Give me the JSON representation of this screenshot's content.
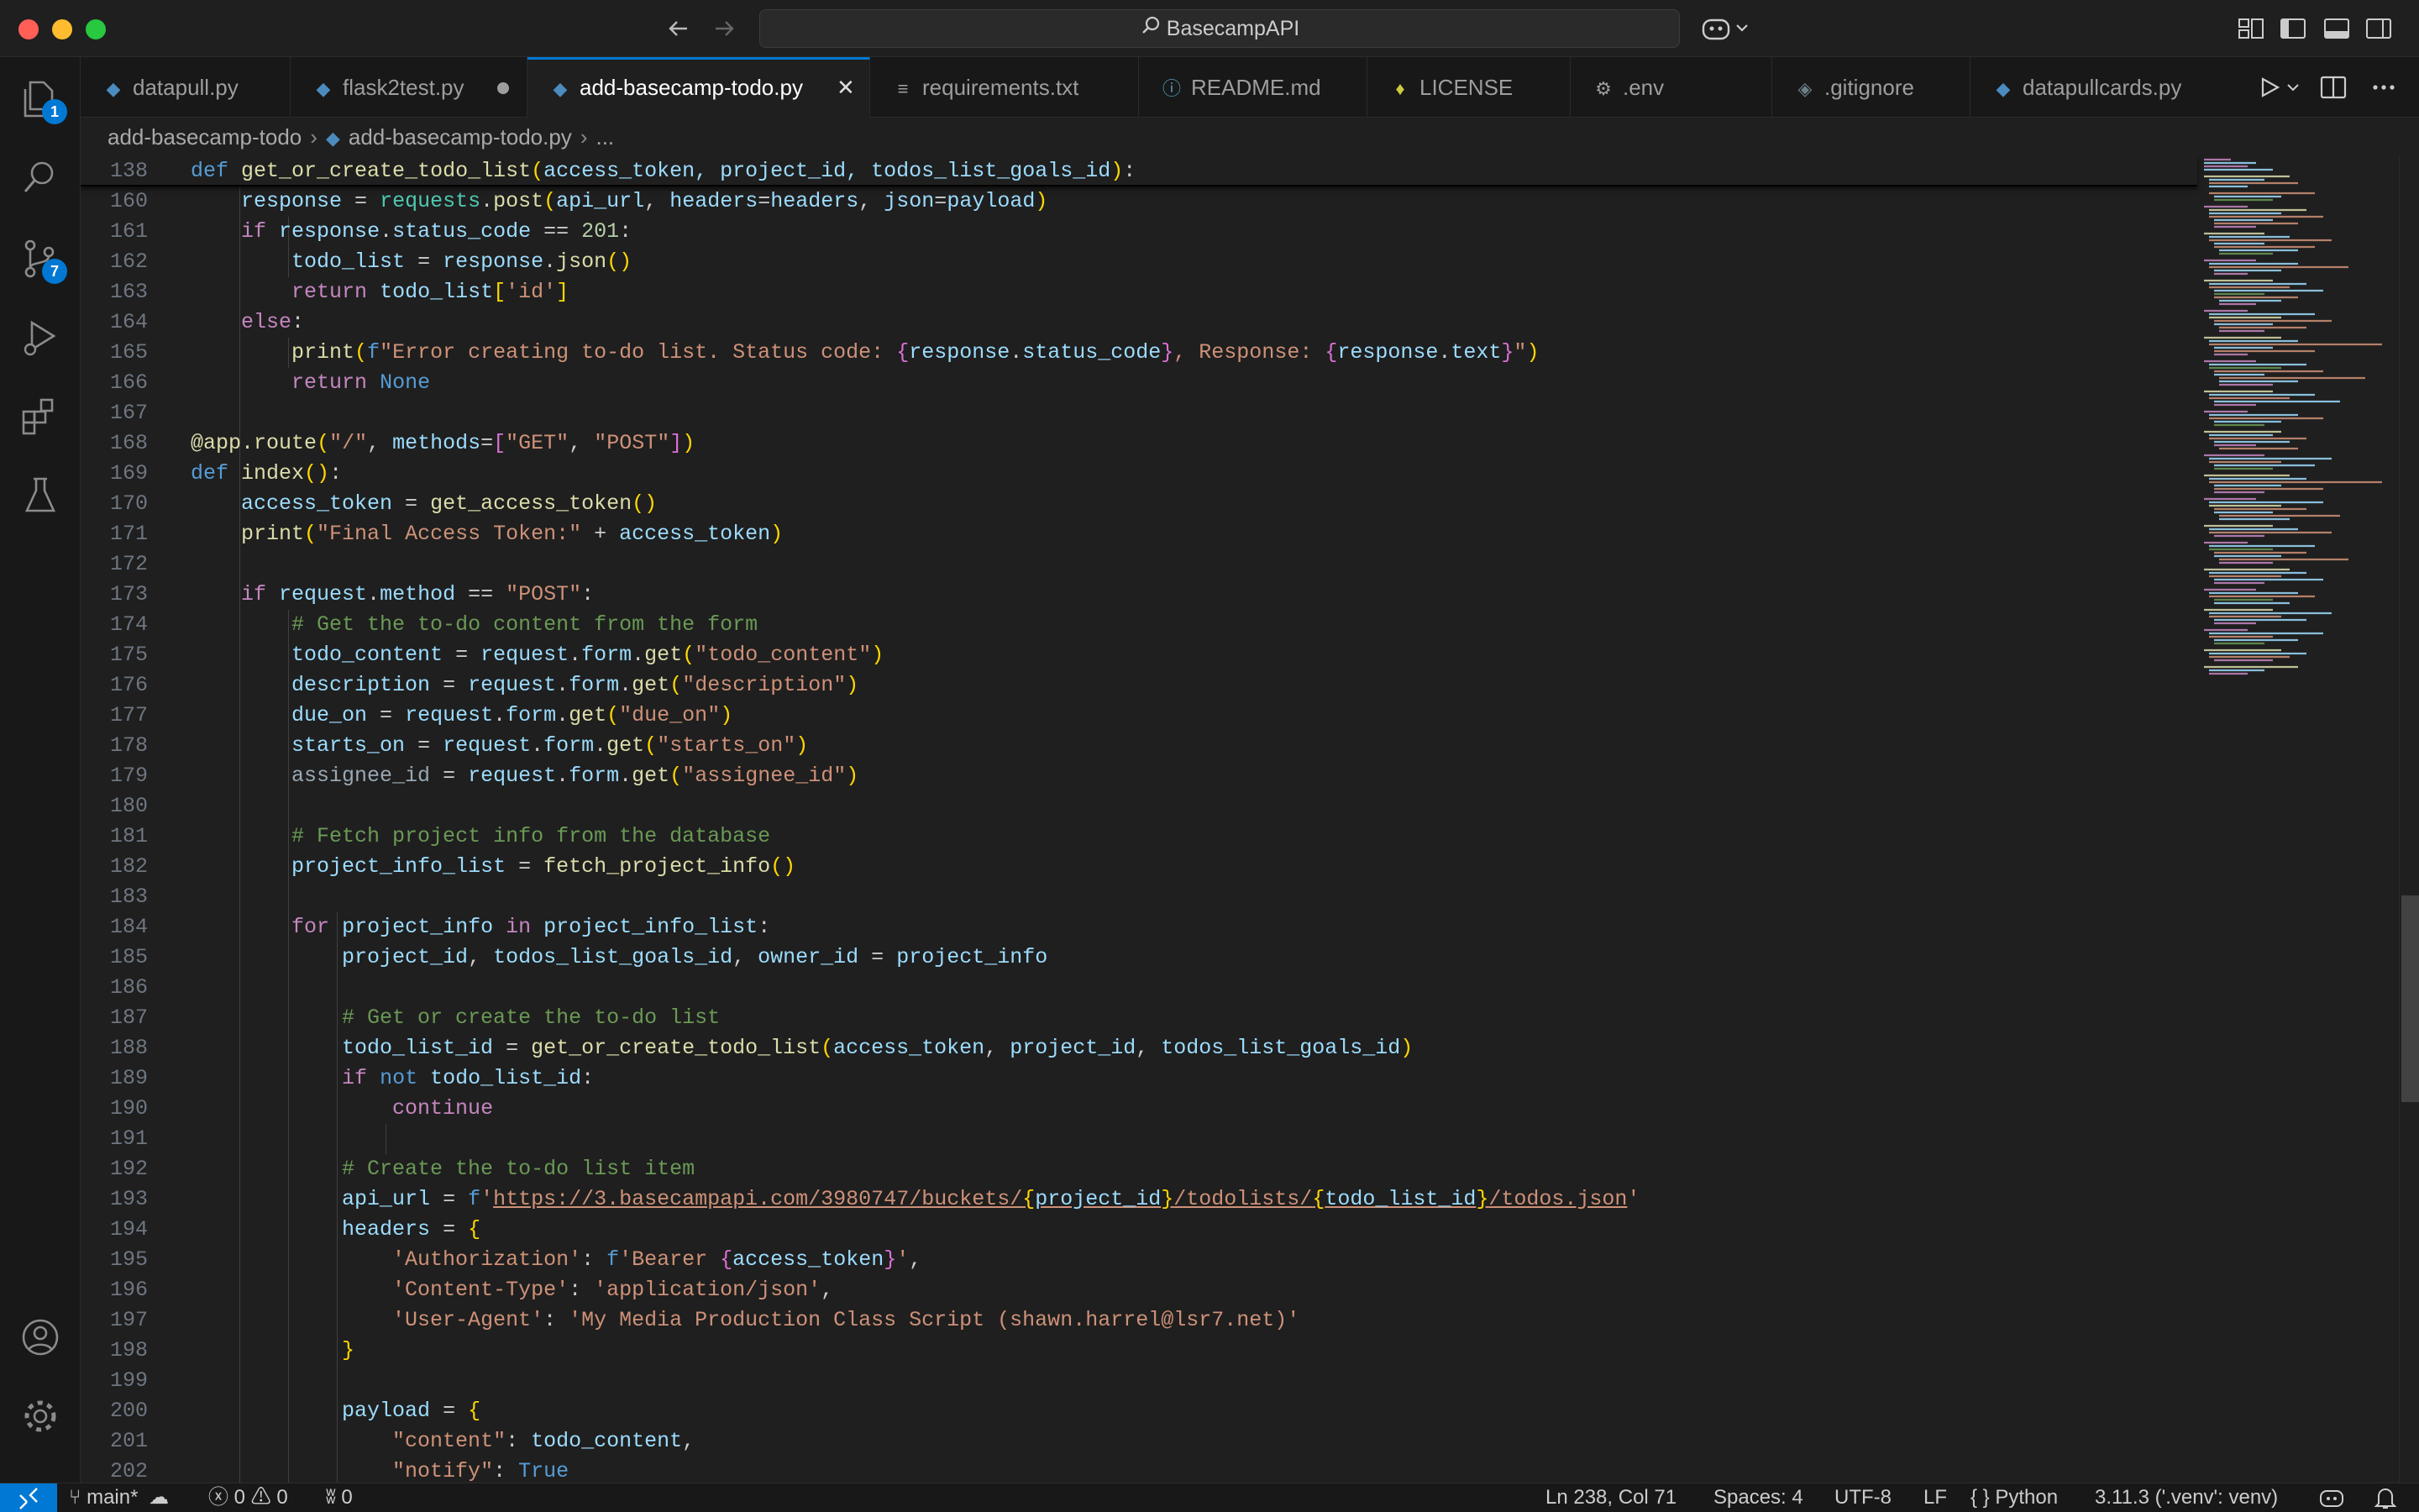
{
  "window": {
    "search_text": "BasecampAPI"
  },
  "activity_bar": {
    "explorer_badge": "1",
    "source_control_badge": "7"
  },
  "tabs": [
    {
      "label": "datapull.py",
      "icon": "python-icon"
    },
    {
      "label": "flask2test.py",
      "icon": "python-icon",
      "modified": true
    },
    {
      "label": "add-basecamp-todo.py",
      "icon": "python-icon",
      "active": true
    },
    {
      "label": "requirements.txt",
      "icon": "text-lines-icon"
    },
    {
      "label": "README.md",
      "icon": "info-icon"
    },
    {
      "label": "LICENSE",
      "icon": "license-icon"
    },
    {
      "label": ".env",
      "icon": "gear-icon"
    },
    {
      "label": ".gitignore",
      "icon": "git-icon"
    },
    {
      "label": "datapullcards.py",
      "icon": "python-icon"
    }
  ],
  "breadcrumb": {
    "folder": "add-basecamp-todo",
    "file": "add-basecamp-todo.py",
    "symbol": "..."
  },
  "code": {
    "sticky_line": "138",
    "line_numbers": [
      "160",
      "161",
      "162",
      "163",
      "164",
      "165",
      "166",
      "167",
      "168",
      "169",
      "170",
      "171",
      "172",
      "173",
      "174",
      "175",
      "176",
      "177",
      "178",
      "179",
      "180",
      "181",
      "182",
      "183",
      "184",
      "185",
      "186",
      "187",
      "188",
      "189",
      "190",
      "191",
      "192",
      "193",
      "194",
      "195",
      "196",
      "197",
      "198",
      "199",
      "200",
      "201",
      "202"
    ],
    "t": {
      "def": "def",
      "fn138": "get_or_create_todo_list",
      "args138": "access_token, project_id, todos_list_goals_id",
      "response": "response",
      "requests": "requests",
      "post": "post",
      "api_url": "api_url",
      "headers_kw": "headers",
      "headers": "headers",
      "json_kw": "json",
      "payload": "payload",
      "if": "if",
      "status_code": "status_code",
      "n201": "201",
      "todo_list": "todo_list",
      "json_fn": "json",
      "return": "return",
      "s_id": "'id'",
      "else": "else",
      "print": "print",
      "f": "f",
      "s165a": "\"Error creating to-do list. Status code: ",
      "s165b": ", Response: ",
      "s165c": "\"",
      "text": "text",
      "None": "None",
      "app": "app",
      "route": "route",
      "s_slash": "\"/\"",
      "methods": "methods",
      "s_get": "\"GET\"",
      "s_post": "\"POST\"",
      "index": "index",
      "access_token": "access_token",
      "get_access_token": "get_access_token",
      "s171": "\"Final Access Token:\"",
      "request": "request",
      "method": "method",
      "c174": "# Get the to-do content from the form",
      "todo_content": "todo_content",
      "form": "form",
      "get": "get",
      "s_todo_content": "\"todo_content\"",
      "description": "description",
      "s_description": "\"description\"",
      "due_on": "due_on",
      "s_due_on": "\"due_on\"",
      "starts_on": "starts_on",
      "s_starts_on": "\"starts_on\"",
      "assignee_id": "assignee_id",
      "s_assignee_id": "\"assignee_id\"",
      "c181": "# Fetch project info from the database",
      "project_info_list": "project_info_list",
      "fetch_project_info": "fetch_project_info",
      "for": "for",
      "project_info": "project_info",
      "in": "in",
      "project_id": "project_id",
      "todos_list_goals_id": "todos_list_goals_id",
      "owner_id": "owner_id",
      "c187": "# Get or create the to-do list",
      "todo_list_id": "todo_list_id",
      "not": "not",
      "continue": "continue",
      "c192": "# Create the to-do list item",
      "url_a": "https://3.basecampapi.com/3980747/buckets/",
      "url_b": "/todolists/",
      "url_c": "/todos.json",
      "s_auth": "'Authorization'",
      "s_bearer": "'Bearer ",
      "s_ct": "'Content-Type'",
      "s_appjson": "'application/json'",
      "s_ua": "'User-Agent'",
      "s_ua_val": "'My Media Production Class Script (shawn.harrel@lsr7.net)'",
      "s_content": "\"content\"",
      "s_notify": "\"notify\"",
      "True": "True"
    }
  },
  "status_bar": {
    "branch": "main*",
    "errors": "0",
    "warnings": "0",
    "ports": "0",
    "cursor": "Ln 238, Col 71",
    "spaces": "Spaces: 4",
    "encoding": "UTF-8",
    "eol": "LF",
    "language": "Python",
    "interpreter": "3.11.3 ('.venv': venv)"
  },
  "colors": {
    "accent": "#0078d4",
    "editor_bg": "#1f1f1f",
    "keyword": "#c586c0",
    "function": "#dcdcaa",
    "variable": "#9cdcfe",
    "string": "#ce9178",
    "comment": "#6a9955"
  }
}
